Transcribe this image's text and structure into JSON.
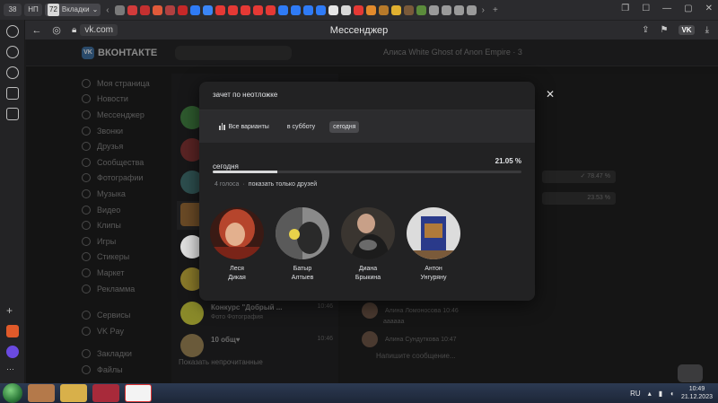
{
  "browser": {
    "tab_count_badge": "38",
    "pinned_tab": "НП",
    "active_tab_num": "72",
    "active_tab_label": "Вкладки",
    "url_host": "vk.com",
    "page_title": "Мессенджер"
  },
  "vk": {
    "logo_text": "ВКОНТАКТЕ",
    "conversation_title": "Алиса White Ghost of Anon Empire · 3",
    "menu": [
      {
        "label": "Моя страница",
        "count": ""
      },
      {
        "label": "Новости",
        "count": ""
      },
      {
        "label": "Мессенджер",
        "count": "11"
      },
      {
        "label": "Звонки",
        "count": ""
      },
      {
        "label": "Друзья",
        "count": "18"
      },
      {
        "label": "Сообщества",
        "count": ""
      },
      {
        "label": "Фотографии",
        "count": "4"
      },
      {
        "label": "Музыка",
        "count": ""
      },
      {
        "label": "Видео",
        "count": ""
      },
      {
        "label": "Клипы",
        "count": ""
      },
      {
        "label": "Игры",
        "count": ""
      },
      {
        "label": "Стикеры",
        "count": ""
      },
      {
        "label": "Маркет",
        "count": ""
      },
      {
        "label": "Рекламма",
        "count": ""
      },
      {
        "label": "Сервисы",
        "count": ""
      },
      {
        "label": "VK Pay",
        "count": ""
      },
      {
        "label": "Закладки",
        "count": "2"
      },
      {
        "label": "Файлы",
        "count": ""
      }
    ],
    "chats": [
      {
        "name": "Конкурс \"Добрый ...",
        "preview": "Фото Фотография",
        "time": "10:46"
      },
      {
        "name": "10 общ♥",
        "preview": "",
        "time": "10:46"
      }
    ],
    "unread_link": "Показать непрочитанные",
    "messages": [
      {
        "author": "Алина Ломоносова",
        "time": "10:46",
        "text": "аааааа"
      },
      {
        "author": "Алина Сундуткова",
        "time": "10:47",
        "text": ""
      }
    ],
    "poll_options": [
      {
        "label": "✓ 78.47 %"
      },
      {
        "label": "23.53 %"
      }
    ],
    "composer_placeholder": "Напишите сообщение..."
  },
  "modal": {
    "title": "зачет по неотложке",
    "filters": [
      {
        "label": "Все варианты",
        "icon": "bar-chart-icon",
        "selected": false
      },
      {
        "label": "в субботу",
        "selected": false
      },
      {
        "label": "сегодня",
        "selected": true
      }
    ],
    "option": {
      "label": "сегодня",
      "percent_text": "21.05 %",
      "fraction": 0.2105
    },
    "votes_count": "4 голоса",
    "separator": "·",
    "friends_only_link": "показать только друзей",
    "voters": [
      {
        "first": "Леся",
        "last": "Дикая"
      },
      {
        "first": "Батыр",
        "last": "Алтыев"
      },
      {
        "first": "Диана",
        "last": "Брыкина"
      },
      {
        "first": "Антон",
        "last": "Унгуряну"
      }
    ],
    "close_icon": "close-icon"
  },
  "taskbar": {
    "lang": "RU",
    "time": "10:49",
    "date": "21.12.2023"
  }
}
